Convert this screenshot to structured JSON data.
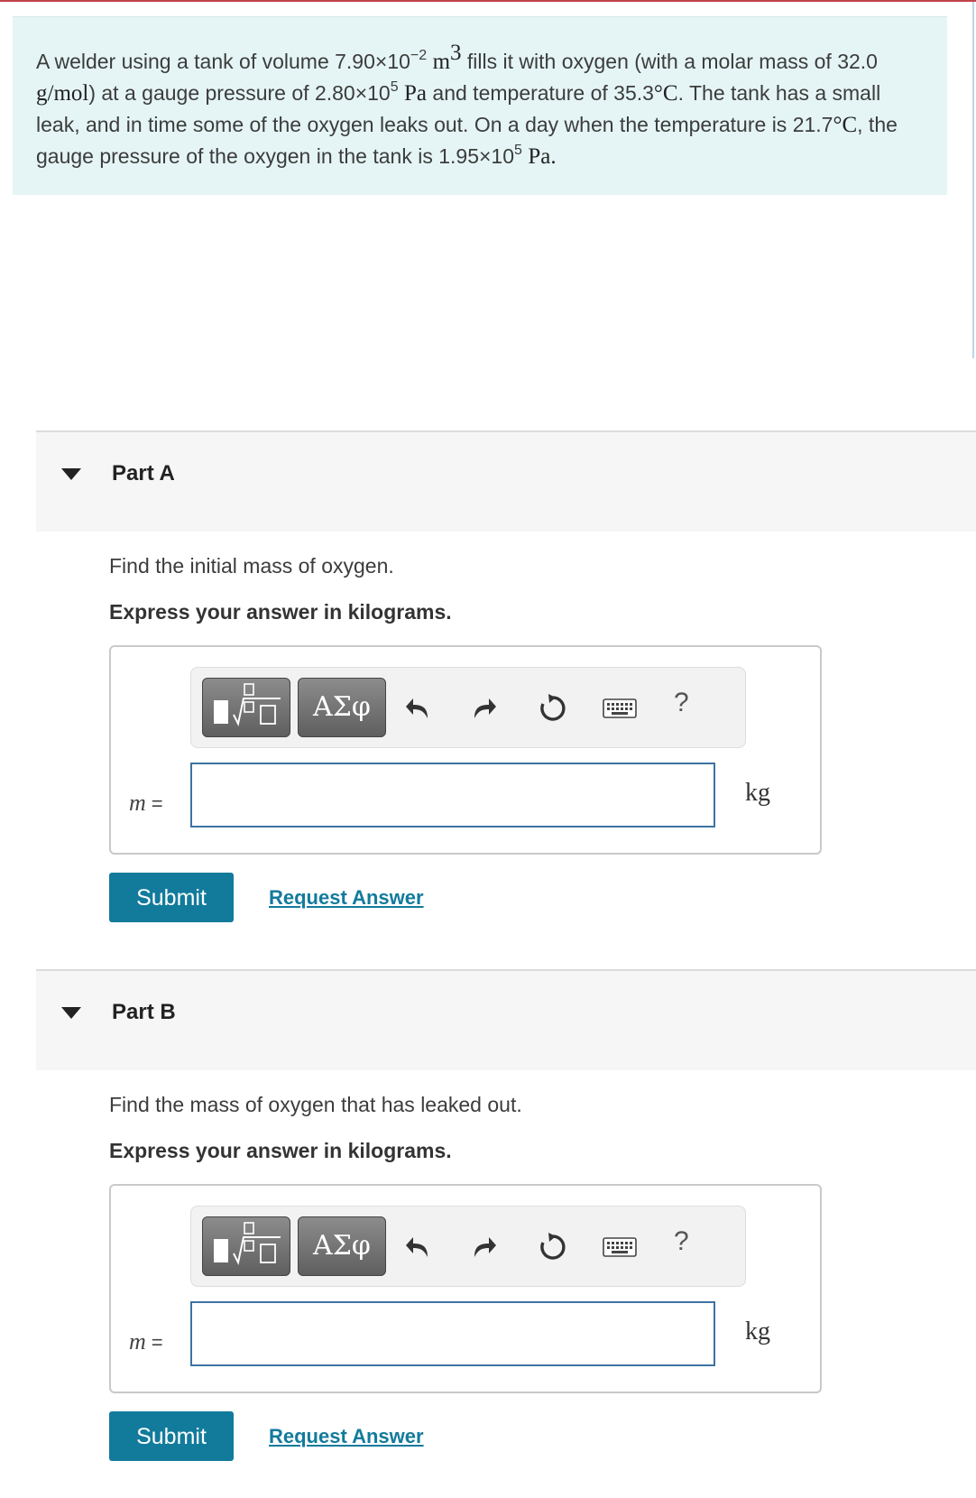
{
  "problem": {
    "seg1": "A welder using a tank of volume 7.90×10",
    "vol_exp": "−2",
    "vol_unit": "m",
    "vol_unit_exp": "3",
    "seg2": " fills it with oxygen (with a molar mass of 32.0 ",
    "molar_unit": "g/mol",
    "seg3": ") at a gauge pressure of 2.80×10",
    "p1_exp": "5",
    "p1_unit": "Pa",
    "seg4": " and temperature of 35.3",
    "t1_unit": "°C",
    "seg5": ". The tank has a small leak, and in time some of the oxygen leaks out. On a day when the temperature is 21.7",
    "t2_unit": "°C",
    "seg6": ", the gauge pressure of the oxygen in the tank is 1.95×10",
    "p2_exp": "5",
    "p2_unit": "Pa",
    "seg7": "."
  },
  "toolbar": {
    "greek_label": "ΑΣφ",
    "help_label": "?"
  },
  "parts": [
    {
      "title": "Part A",
      "prompt": "Find the initial mass of oxygen.",
      "instruction": "Express your answer in kilograms.",
      "variable": "m",
      "equals": "=",
      "unit": "kg",
      "input_value": "",
      "submit_label": "Submit",
      "request_label": "Request Answer"
    },
    {
      "title": "Part B",
      "prompt": "Find the mass of oxygen that has leaked out.",
      "instruction": "Express your answer in kilograms.",
      "variable": "m",
      "equals": "=",
      "unit": "kg",
      "input_value": "",
      "submit_label": "Submit",
      "request_label": "Request Answer"
    }
  ]
}
